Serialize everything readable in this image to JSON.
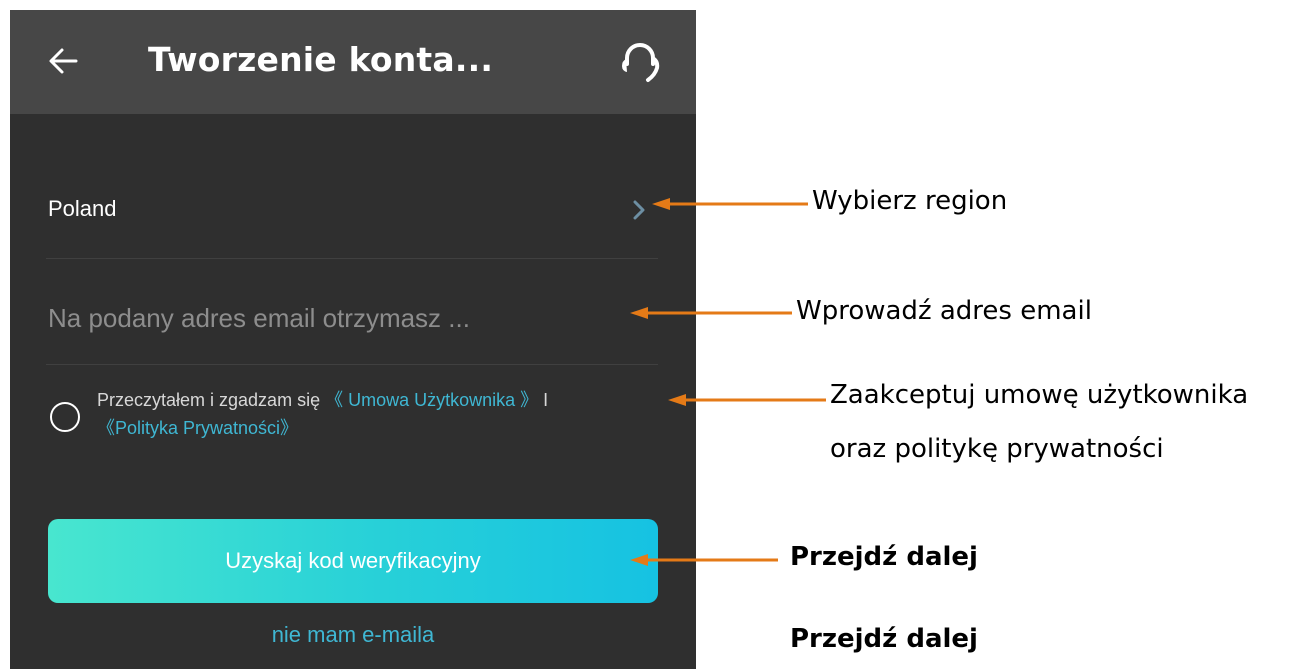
{
  "header": {
    "title": "Tworzenie konta...",
    "back_icon": "arrow-left-icon",
    "support_icon": "headset-icon"
  },
  "form": {
    "region_value": "Poland",
    "email_placeholder": "Na podany adres email otrzymasz ...",
    "agreement_prefix": "Przeczytałem i zgadzam się ",
    "user_agreement_link": "《 Umowa Użytkownika 》",
    "agreement_joiner": " I ",
    "privacy_policy_link": "《Polityka Prywatności》",
    "submit_label": "Uzyskaj kod weryfikacyjny",
    "no_email_link": "nie mam e-maila"
  },
  "annotations": {
    "region": "Wybierz region",
    "email": "Wprowadź adres email",
    "agreement_line1": "Zaakceptuj umowę użytkownika",
    "agreement_line2": "oraz politykę prywatności",
    "submit": "Przejdź dalej",
    "no_email": "Przejdź dalej"
  },
  "colors": {
    "topbar": "#474747",
    "background": "#2f2f2f",
    "link": "#3fb7d3",
    "button_gradient_start": "#48e6cf",
    "button_gradient_end": "#16c2e2",
    "annotation_arrow": "#e47a17"
  }
}
